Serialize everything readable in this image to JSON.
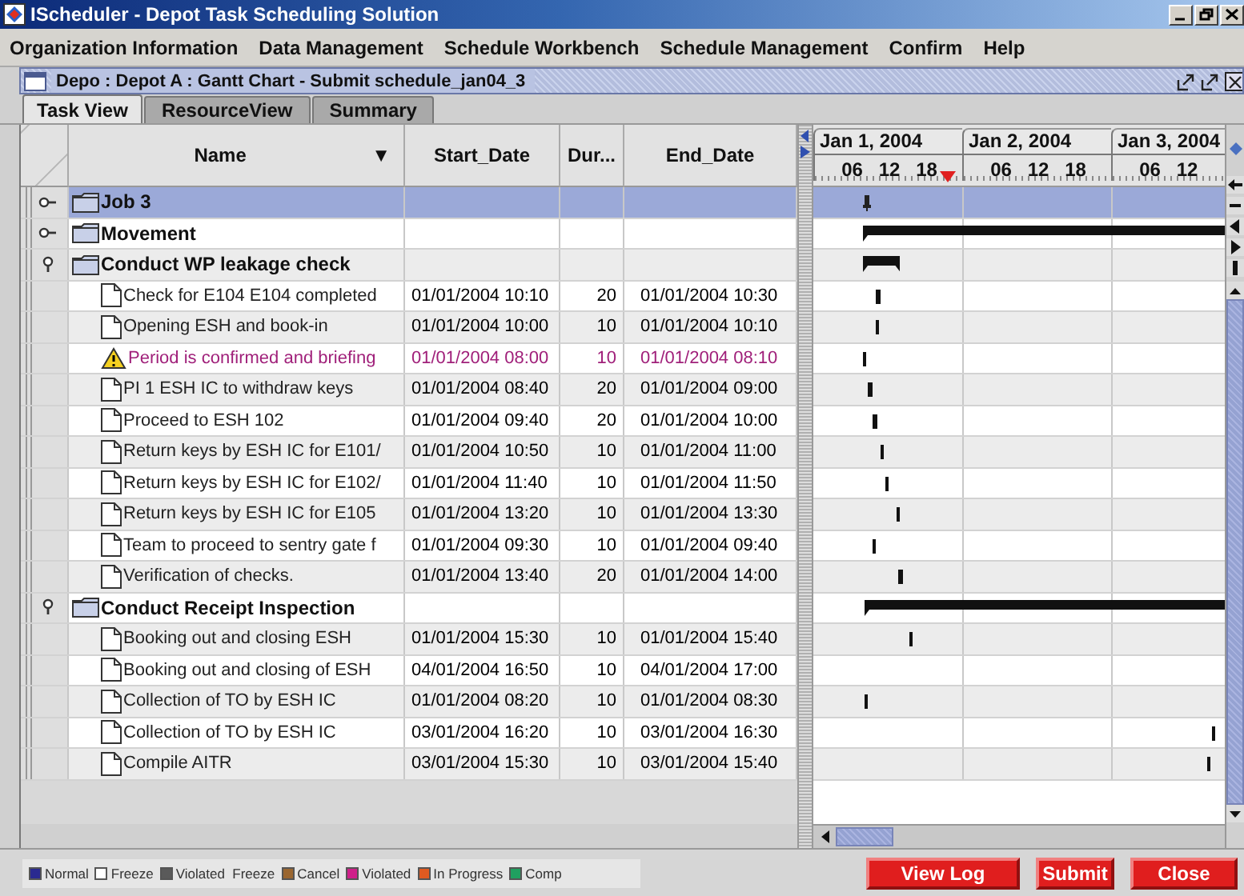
{
  "window": {
    "title": "IScheduler - Depot Task Scheduling Solution"
  },
  "menu": [
    "Organization Information",
    "Data Management",
    "Schedule Workbench",
    "Schedule Management",
    "Confirm",
    "Help"
  ],
  "frame": {
    "title": "Depo : Depot A : Gantt Chart - Submit schedule_jan04_3"
  },
  "tabs": [
    {
      "label": "Task View",
      "selected": true
    },
    {
      "label": "ResourceView",
      "selected": false
    },
    {
      "label": "Summary",
      "selected": false
    }
  ],
  "table": {
    "columns": [
      "Name",
      "Start_Date",
      "Dur...",
      "End_Date"
    ],
    "sort_indicator": "▼",
    "rows": [
      {
        "name": "Job 3",
        "expanded": false,
        "selected": true,
        "kind": "milestone",
        "children": []
      },
      {
        "name": "Movement",
        "expanded": false,
        "selected": false,
        "kind": "summary",
        "children": []
      },
      {
        "name": "Conduct WP leakage check",
        "expanded": true,
        "selected": false,
        "kind": "summary",
        "children": [
          {
            "name": "Check for E104 E104 completed",
            "start": "01/01/2004 10:10",
            "duration": "20",
            "end": "01/01/2004 10:30",
            "violated": false,
            "selected": false
          },
          {
            "name": "Opening ESH and book-in",
            "start": "01/01/2004 10:00",
            "duration": "10",
            "end": "01/01/2004 10:10",
            "violated": false,
            "selected": false
          },
          {
            "name": "Period is confirmed and briefing",
            "start": "01/01/2004 08:00",
            "duration": "10",
            "end": "01/01/2004 08:10",
            "violated": true,
            "selected": false
          },
          {
            "name": "PI 1 ESH IC to withdraw keys",
            "start": "01/01/2004 08:40",
            "duration": "20",
            "end": "01/01/2004 09:00",
            "violated": false,
            "selected": false
          },
          {
            "name": "Proceed to ESH 102",
            "start": "01/01/2004 09:40",
            "duration": "20",
            "end": "01/01/2004 10:00",
            "violated": false,
            "selected": false
          },
          {
            "name": "Return keys by ESH IC for E101/",
            "start": "01/01/2004 10:50",
            "duration": "10",
            "end": "01/01/2004 11:00",
            "violated": false,
            "selected": false
          },
          {
            "name": "Return keys by ESH IC for E102/",
            "start": "01/01/2004 11:40",
            "duration": "10",
            "end": "01/01/2004 11:50",
            "violated": false,
            "selected": false
          },
          {
            "name": "Return keys by ESH IC for E105",
            "start": "01/01/2004 13:20",
            "duration": "10",
            "end": "01/01/2004 13:30",
            "violated": false,
            "selected": false
          },
          {
            "name": "Team to proceed to sentry gate f",
            "start": "01/01/2004 09:30",
            "duration": "10",
            "end": "01/01/2004 09:40",
            "violated": false,
            "selected": false
          },
          {
            "name": "Verification of checks.",
            "start": "01/01/2004 13:40",
            "duration": "20",
            "end": "01/01/2004 14:00",
            "violated": false,
            "selected": false
          }
        ]
      },
      {
        "name": "Conduct Receipt Inspection",
        "expanded": true,
        "selected": false,
        "kind": "summary",
        "children": [
          {
            "name": "Booking out and closing ESH",
            "start": "01/01/2004 15:30",
            "duration": "10",
            "end": "01/01/2004 15:40",
            "violated": false,
            "selected": false
          },
          {
            "name": "Booking out and closing of ESH",
            "start": "04/01/2004 16:50",
            "duration": "10",
            "end": "04/01/2004 17:00",
            "violated": false,
            "selected": false
          },
          {
            "name": "Collection of TO by ESH IC",
            "start": "01/01/2004 08:20",
            "duration": "10",
            "end": "01/01/2004 08:30",
            "violated": false,
            "selected": false
          },
          {
            "name": "Collection of TO by ESH IC",
            "start": "03/01/2004 16:20",
            "duration": "10",
            "end": "03/01/2004 16:30",
            "violated": false,
            "selected": false
          },
          {
            "name": "Compile AITR",
            "start": "03/01/2004 15:30",
            "duration": "10",
            "end": "03/01/2004 15:40",
            "violated": false,
            "selected": false
          }
        ]
      }
    ]
  },
  "gantt": {
    "days": [
      {
        "label": "Jan 1, 2004",
        "hours": [
          {
            "label": "06",
            "marker": false
          },
          {
            "label": "12",
            "marker": false
          },
          {
            "label": "18",
            "marker": true
          }
        ]
      },
      {
        "label": "Jan 2, 2004",
        "hours": [
          {
            "label": "06",
            "marker": false
          },
          {
            "label": "12",
            "marker": false
          },
          {
            "label": "18",
            "marker": false
          }
        ]
      },
      {
        "label": "Jan 3, 2004",
        "hours": [
          {
            "label": "06",
            "marker": false
          },
          {
            "label": "12",
            "marker": false
          }
        ]
      }
    ]
  },
  "legend": [
    {
      "label": "Normal",
      "color": "#2a2a90"
    },
    {
      "label": "Freeze",
      "color": "#ffffff"
    },
    {
      "label": "Violated  Freeze",
      "color": "#5a5a5a"
    },
    {
      "label": "Cancel",
      "color": "#9a6630"
    },
    {
      "label": "Violated",
      "color": "#d0208a"
    },
    {
      "label": "In Progress",
      "color": "#e05a20"
    },
    {
      "label": "Comp",
      "color": "#20a060"
    }
  ],
  "buttons": [
    "View Log",
    "Submit",
    "Close"
  ]
}
